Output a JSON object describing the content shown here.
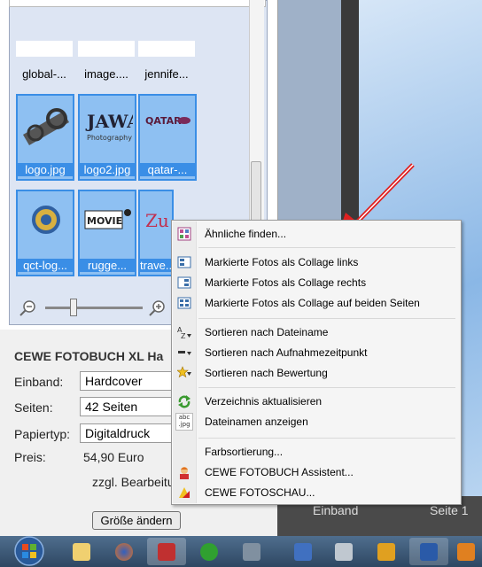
{
  "thumbnails": [
    {
      "caption": "global-...",
      "selected": false
    },
    {
      "caption": "image....",
      "selected": false
    },
    {
      "caption": "jennife...",
      "selected": false
    },
    {
      "caption": "logo.jpg",
      "selected": true
    },
    {
      "caption": "logo2.jpg",
      "selected": true
    },
    {
      "caption": "qatar-...",
      "selected": true
    },
    {
      "caption": "qct-log...",
      "selected": true
    },
    {
      "caption": "rugge...",
      "selected": true
    },
    {
      "caption": "trave...",
      "selected": true
    }
  ],
  "thumb_logos": {
    "jawan": "JAWAN",
    "jawan_sub": "Photography",
    "qatar": "QATAR",
    "movie": "MOVIE"
  },
  "product": {
    "title": "CEWE FOTOBUCH XL Ha",
    "binding_label": "Einband:",
    "binding_value": "Hardcover",
    "pages_label": "Seiten:",
    "pages_value": "42 Seiten",
    "paper_label": "Papiertyp:",
    "paper_value": "Digitaldruck",
    "price_label": "Preis:",
    "price_value": "54,90 Euro",
    "shipping_note": "zzgl. Bearbeitu",
    "resize_button": "Größe ändern"
  },
  "doc_footer": {
    "binding": "Einband",
    "page": "Seite 1"
  },
  "context_menu": {
    "items": [
      {
        "label": "Ähnliche finden...",
        "icon": "grid-icon"
      },
      {
        "label": "Markierte Fotos als Collage links",
        "icon": "collage-left-icon"
      },
      {
        "label": "Markierte Fotos als Collage rechts",
        "icon": "collage-right-icon"
      },
      {
        "label": "Markierte Fotos als Collage auf beiden Seiten",
        "icon": "collage-both-icon"
      },
      {
        "label": "Sortieren nach Dateiname",
        "icon": "sort-az-icon"
      },
      {
        "label": "Sortieren nach Aufnahmezeitpunkt",
        "icon": "sort-time-icon"
      },
      {
        "label": "Sortieren nach Bewertung",
        "icon": "star-icon"
      },
      {
        "label": "Verzeichnis aktualisieren",
        "icon": "refresh-icon"
      },
      {
        "label": "Dateinamen anzeigen",
        "icon": "abc-jpg-icon"
      },
      {
        "label": "Farbsortierung...",
        "icon": ""
      },
      {
        "label": "CEWE FOTOBUCH Assistent...",
        "icon": "assistant-icon"
      },
      {
        "label": "CEWE FOTOSCHAU...",
        "icon": "slideshow-icon"
      }
    ],
    "abc_icon_text": "abc .jpg"
  },
  "colors": {
    "selection": "#3a8ee6",
    "arrow": "#e02020",
    "menu_bg": "#f5f5f5"
  }
}
